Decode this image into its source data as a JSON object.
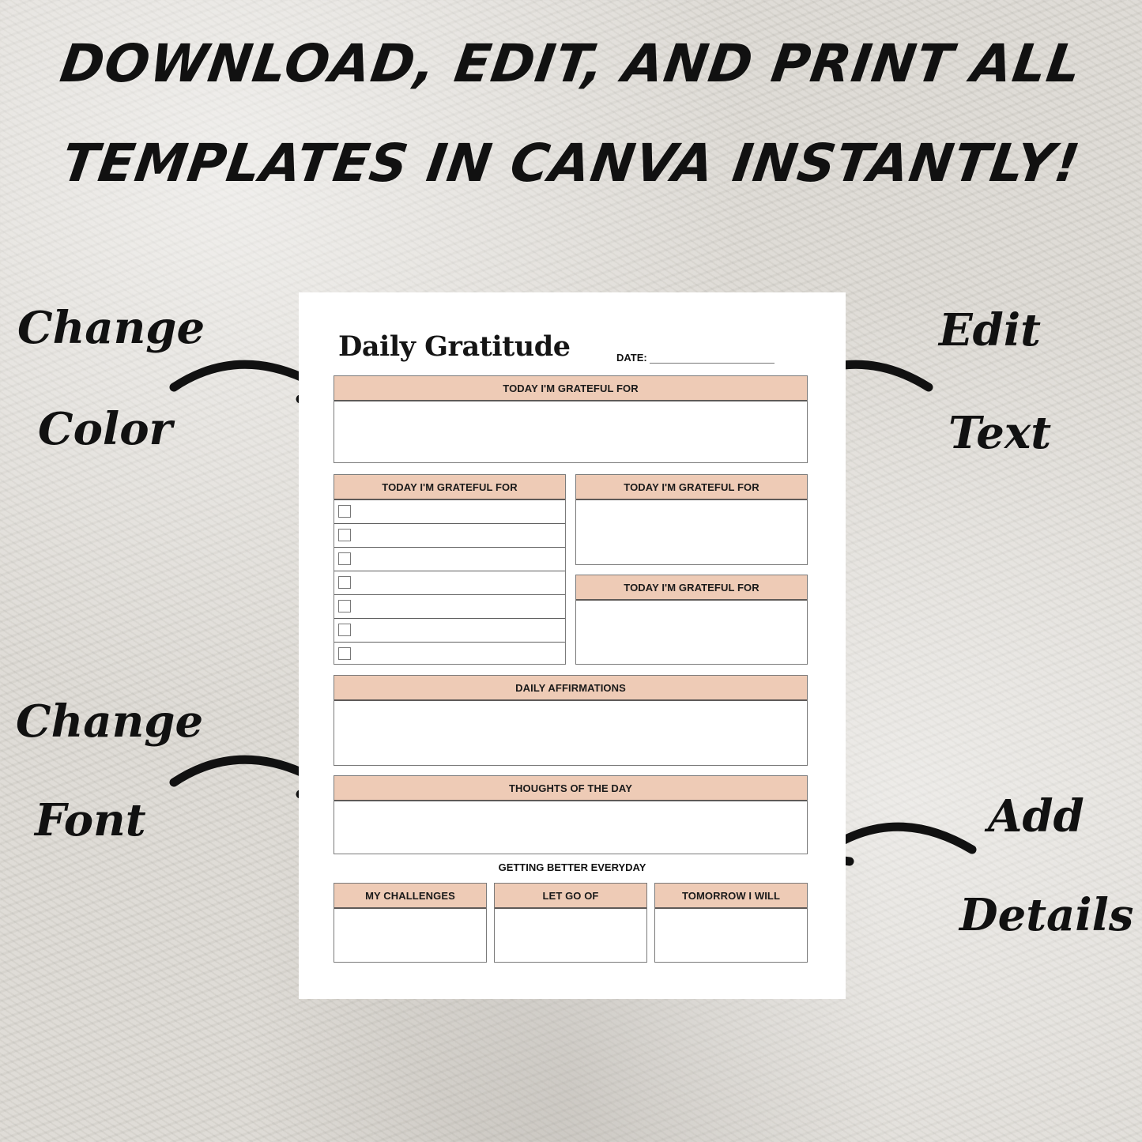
{
  "headline": {
    "line1": "DOWNLOAD, EDIT, AND PRINT ALL",
    "line2": "TEMPLATES IN CANVA INSTANTLY!"
  },
  "annotations": {
    "change_color": [
      "Change",
      "Color"
    ],
    "edit_text": [
      "Edit",
      "Text"
    ],
    "change_font": [
      "Change",
      "Font"
    ],
    "add_details": [
      "Add",
      "Details"
    ]
  },
  "template": {
    "title": "Daily Gratitude",
    "date_label": "DATE:",
    "header_color": "#eecbb6",
    "sections": {
      "top": "TODAY I'M GRATEFUL FOR",
      "checklist": "TODAY I'M GRATEFUL FOR",
      "right_top": "TODAY I'M GRATEFUL FOR",
      "right_bottom": "TODAY I'M GRATEFUL FOR",
      "affirmations": "DAILY AFFIRMATIONS",
      "thoughts": "THOUGHTS OF THE DAY"
    },
    "checklist_count": 7,
    "subtitle": "GETTING BETTER EVERYDAY",
    "bottom_boxes": [
      "MY CHALLENGES",
      "LET GO OF",
      "TOMORROW I WILL"
    ]
  }
}
